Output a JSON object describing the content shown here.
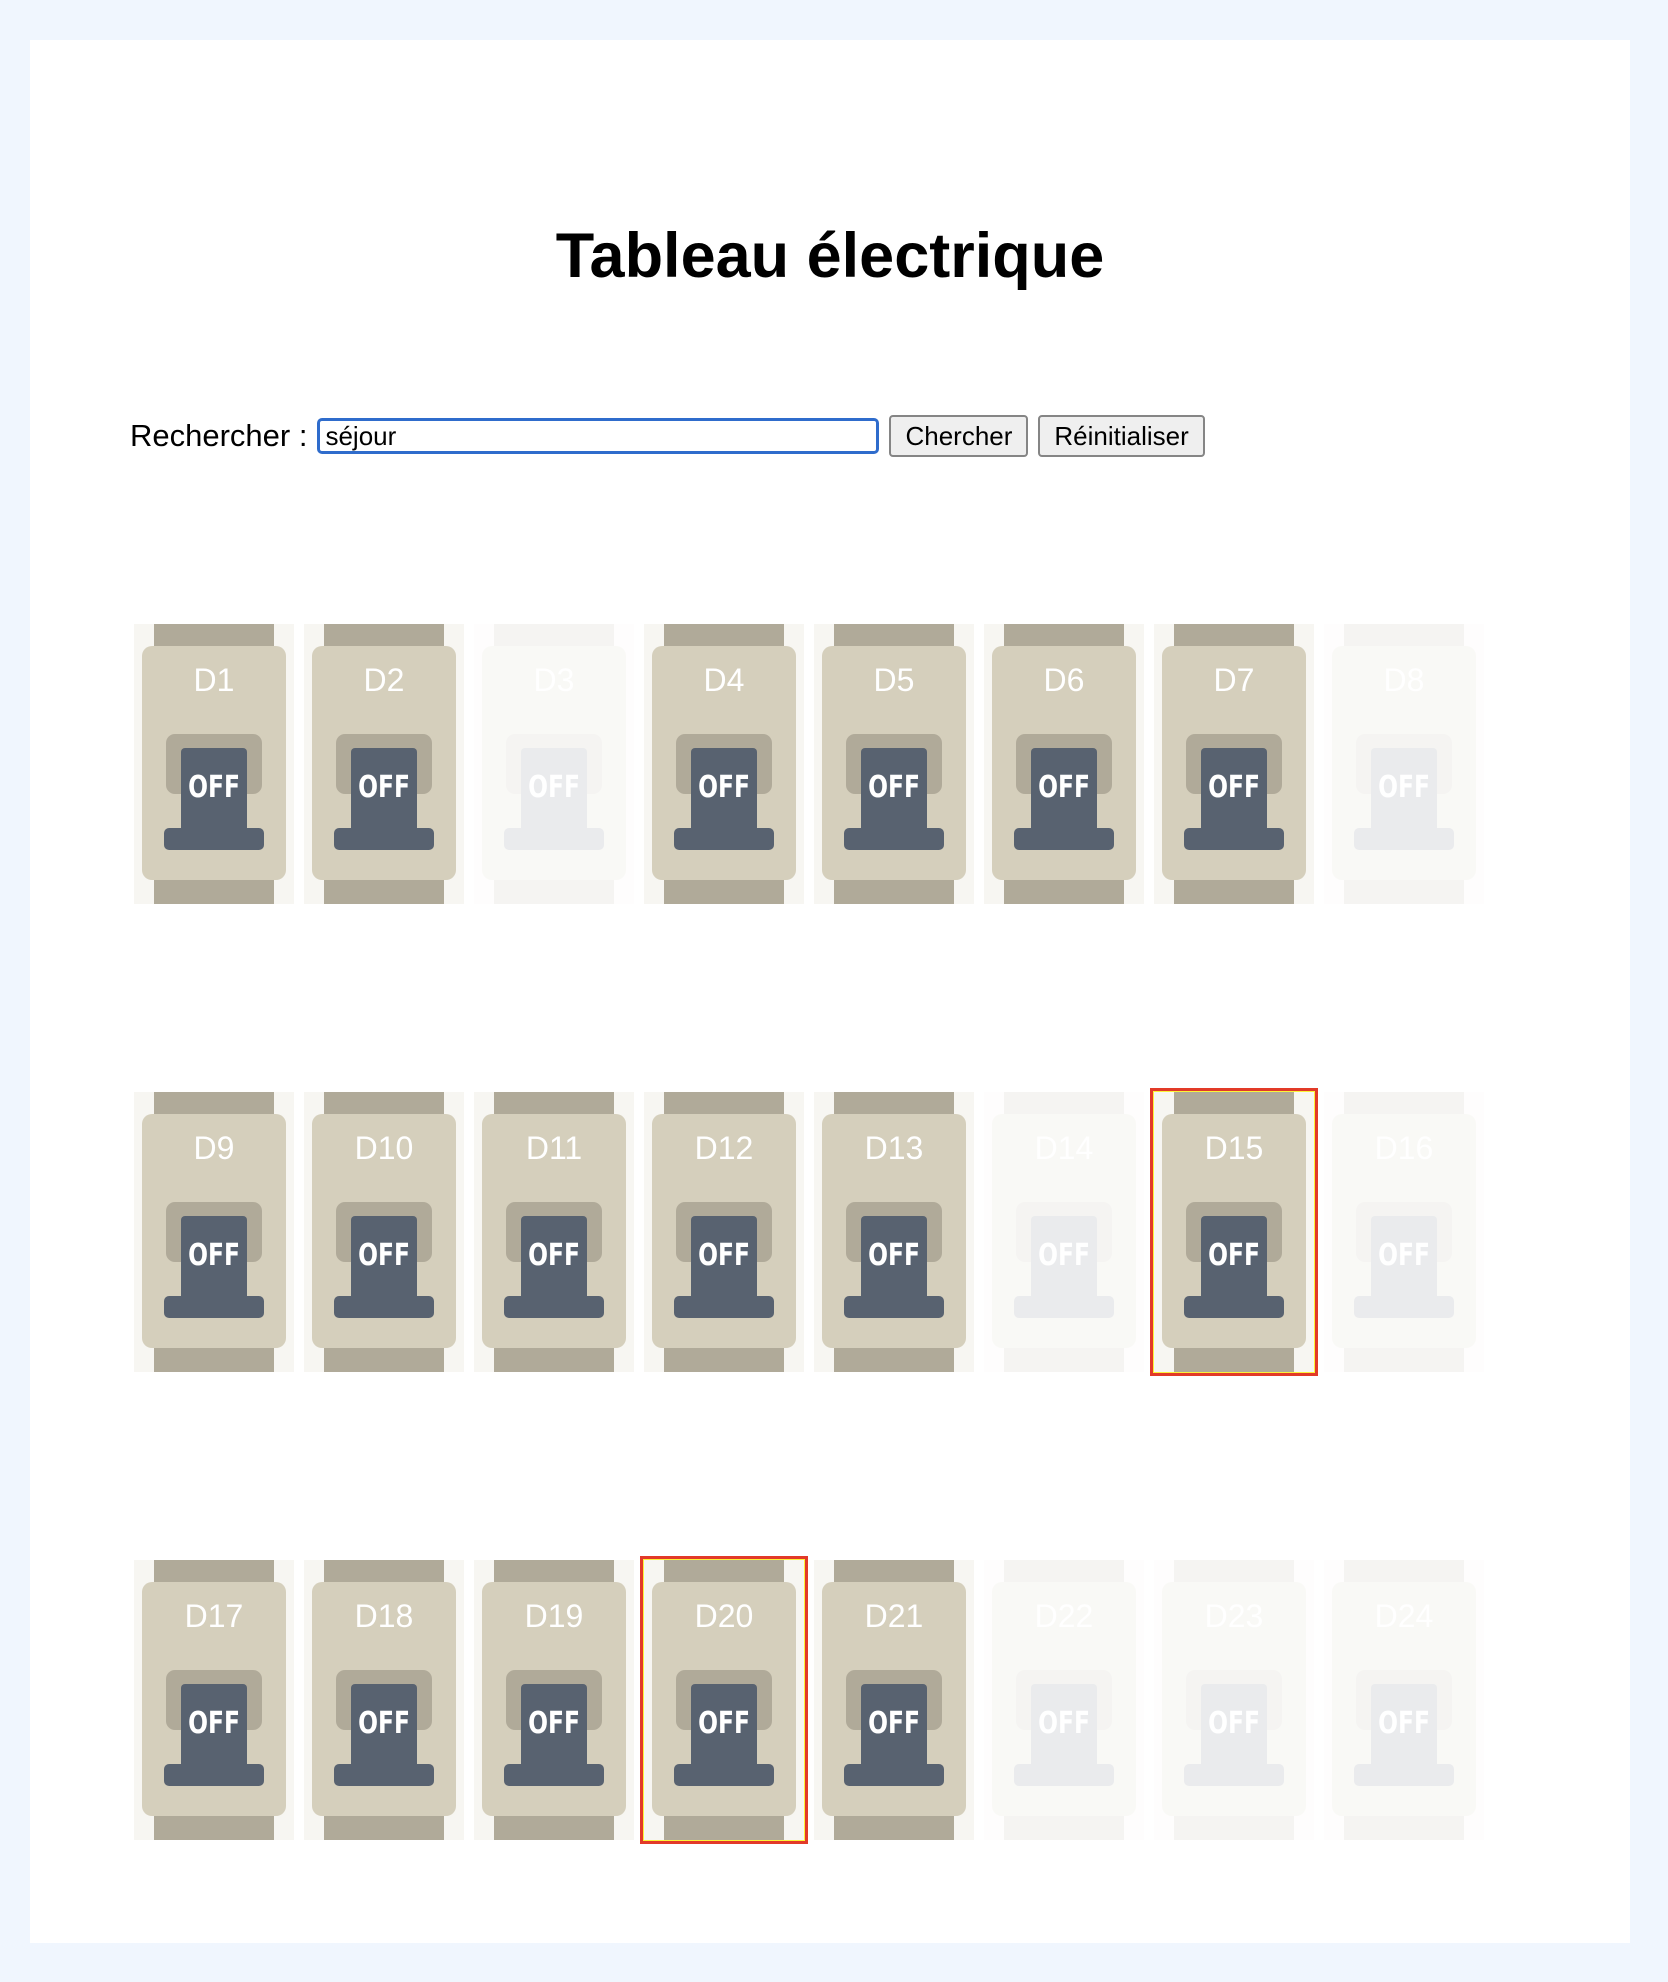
{
  "page": {
    "title": "Tableau électrique"
  },
  "search": {
    "label": "Rechercher :",
    "value": "séjour",
    "button_search": "Chercher",
    "button_reset": "Réinitialiser"
  },
  "switch_state_label": "OFF",
  "breakers": [
    {
      "label": "D1",
      "matched": true,
      "highlighted": false
    },
    {
      "label": "D2",
      "matched": true,
      "highlighted": false
    },
    {
      "label": "D3",
      "matched": false,
      "highlighted": false
    },
    {
      "label": "D4",
      "matched": true,
      "highlighted": false
    },
    {
      "label": "D5",
      "matched": true,
      "highlighted": false
    },
    {
      "label": "D6",
      "matched": true,
      "highlighted": false
    },
    {
      "label": "D7",
      "matched": true,
      "highlighted": false
    },
    {
      "label": "D8",
      "matched": false,
      "highlighted": false
    },
    {
      "label": "D9",
      "matched": true,
      "highlighted": false
    },
    {
      "label": "D10",
      "matched": true,
      "highlighted": false
    },
    {
      "label": "D11",
      "matched": true,
      "highlighted": false
    },
    {
      "label": "D12",
      "matched": true,
      "highlighted": false
    },
    {
      "label": "D13",
      "matched": true,
      "highlighted": false
    },
    {
      "label": "D14",
      "matched": false,
      "highlighted": false
    },
    {
      "label": "D15",
      "matched": true,
      "highlighted": true
    },
    {
      "label": "D16",
      "matched": false,
      "highlighted": false
    },
    {
      "label": "D17",
      "matched": true,
      "highlighted": false
    },
    {
      "label": "D18",
      "matched": true,
      "highlighted": false
    },
    {
      "label": "D19",
      "matched": true,
      "highlighted": false
    },
    {
      "label": "D20",
      "matched": true,
      "highlighted": true
    },
    {
      "label": "D21",
      "matched": true,
      "highlighted": false
    },
    {
      "label": "D22",
      "matched": false,
      "highlighted": false
    },
    {
      "label": "D23",
      "matched": false,
      "highlighted": false
    },
    {
      "label": "D24",
      "matched": false,
      "highlighted": false
    }
  ],
  "colors": {
    "page_background": "#f0f6fe",
    "breaker_body": "#d5cfbc",
    "breaker_rail": "#b0aa99",
    "toggle": "#586270",
    "highlight_fill": "#fbf43a",
    "highlight_border": "#e23a28"
  }
}
